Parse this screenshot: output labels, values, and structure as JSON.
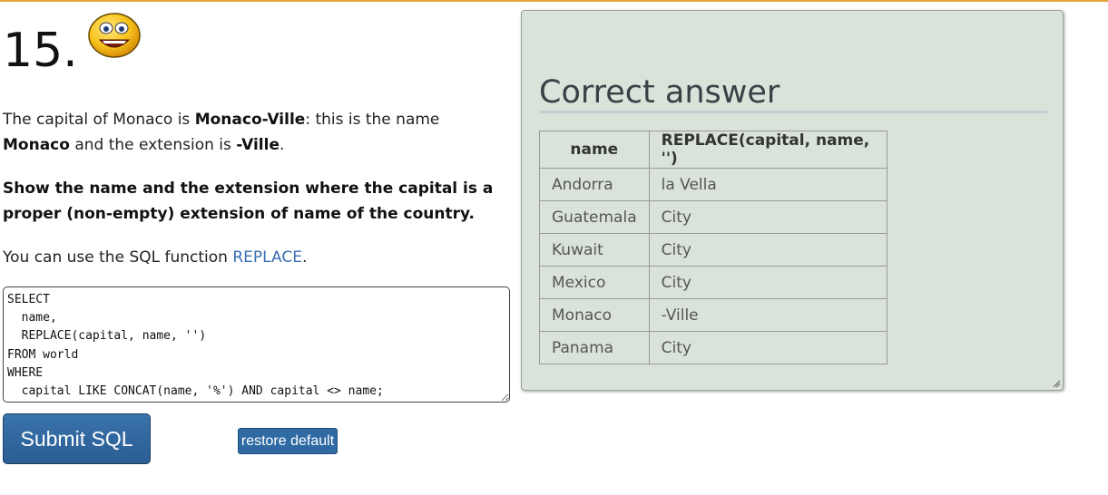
{
  "question": {
    "number": "15.",
    "p1": {
      "t1": "The capital of Monaco is ",
      "b1": "Monaco-Ville",
      "t2": ": this is the name ",
      "b2": "Monaco",
      "t3": " and the extension is ",
      "b3": "-Ville",
      "t4": "."
    },
    "task": "Show the name and the extension where the capital is a proper (non-empty) extension of name of the country.",
    "hint": {
      "before": "You can use the SQL function ",
      "link": "REPLACE",
      "after": "."
    }
  },
  "editor": {
    "sql": "SELECT\n  name,\n  REPLACE(capital, name, '')\nFROM world\nWHERE\n  capital LIKE CONCAT(name, '%') AND capital <> name;"
  },
  "buttons": {
    "submit": "Submit SQL",
    "restore": "restore default"
  },
  "answer": {
    "title": "Correct answer",
    "columns": [
      "name",
      "REPLACE(capital, name, '')"
    ],
    "rows": [
      [
        "Andorra",
        "la Vella"
      ],
      [
        "Guatemala",
        "City"
      ],
      [
        "Kuwait",
        "City"
      ],
      [
        "Mexico",
        "City"
      ],
      [
        "Monaco",
        "-Ville"
      ],
      [
        "Panama",
        "City"
      ]
    ]
  },
  "colors": {
    "accent_rule": "#e8a23a",
    "button_blue": "#2f6aa3",
    "panel_bg": "#dae3da",
    "link": "#3a6fb0"
  },
  "icons": {
    "smiley": "smiley-face-icon"
  }
}
